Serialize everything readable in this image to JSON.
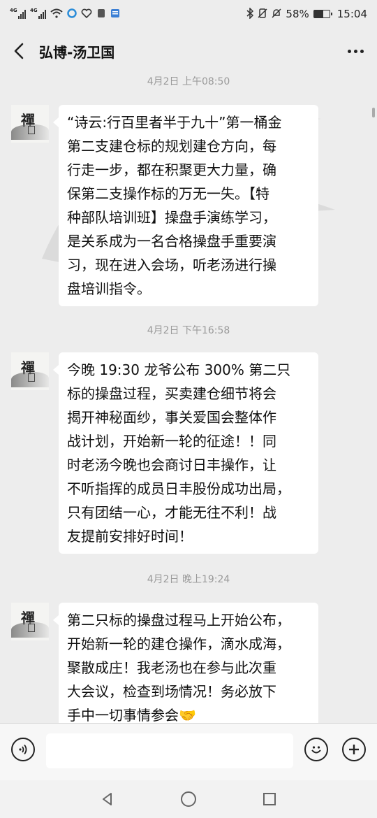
{
  "status_bar": {
    "network_1": "4G",
    "network_2": "4G",
    "battery_percent": "58%",
    "battery_level": 0.58,
    "time": "15:04"
  },
  "header": {
    "title": "弘博-汤卫国"
  },
  "messages": [
    {
      "timestamp": "4月2日 上午08:50",
      "text": "“诗云:行百里者半于九十”第一桶金\n第二支建仓标的规划建仓方向，每\n行走一步，都在积聚更大力量，确\n保第二支操作标的万无一失。【特\n种部队培训班】操盘手演练学习，\n是关系成为一名合格操盘手重要演\n习，现在进入会场，听老汤进行操\n盘培训指令。"
    },
    {
      "timestamp": "4月2日 下午16:58",
      "text": "今晚 19:30 龙爷公布 300% 第二只\n标的操盘过程，买卖建仓细节将会\n揭开神秘面纱，事关爱国会整体作\n战计划，开始新一轮的征途！！同\n时老汤今晚也会商讨日丰操作，让\n不听指挥的成员日丰股份成功出局，\n只有团结一心，才能无往不利！战\n友提前安排好时间！"
    },
    {
      "timestamp": "4月2日 晚上19:24",
      "text": "第二只标的操盘过程马上开始公布，\n开始新一轮的建仓操作，滴水成海，\n聚散成庄！我老汤也在参与此次重\n大会议，检查到场情况！务必放下\n手中一切事情参会🤝"
    }
  ],
  "avatar": {
    "char": "禪"
  },
  "input_bar": {
    "value": ""
  },
  "icons": {
    "voice": "voice-icon",
    "emoji": "emoji-icon",
    "add": "add-icon",
    "back": "chevron-left-icon",
    "more": "more-icon"
  }
}
